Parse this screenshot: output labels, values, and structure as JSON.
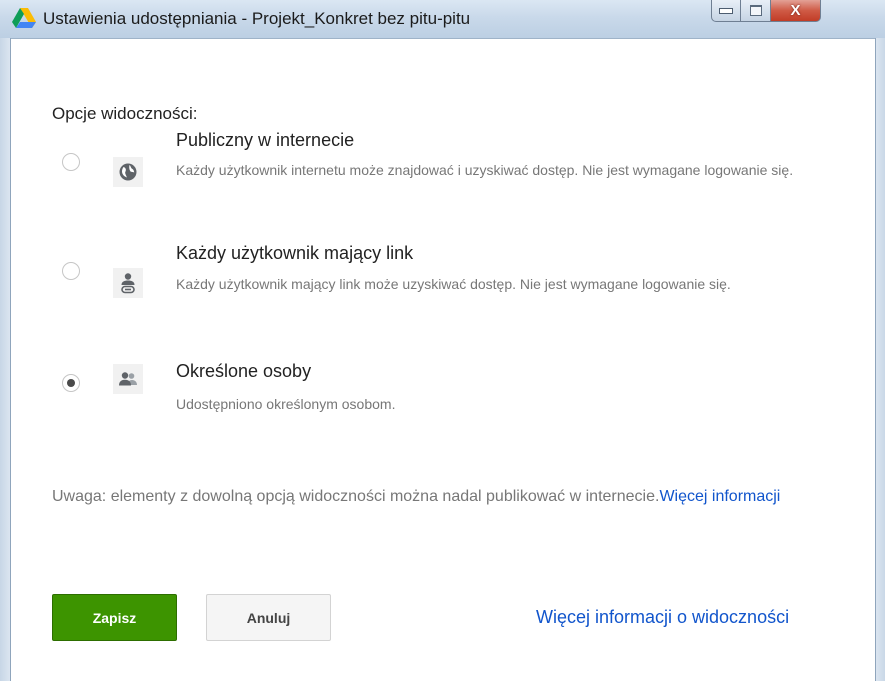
{
  "window": {
    "title": "Ustawienia udostępniania - Projekt_Konkret bez pitu-pitu",
    "app_icon": "google-drive-icon",
    "controls": {
      "minimize_icon": "minimize-icon",
      "maximize_icon": "maximize-icon",
      "close_glyph": "X"
    }
  },
  "visibility": {
    "heading": "Opcje widoczności:",
    "options": [
      {
        "title": "Publiczny w internecie",
        "description": "Każdy użytkownik internetu może znajdować i uzyskiwać dostęp. Nie jest wymagane logowanie się.",
        "icon": "globe-icon",
        "selected": false
      },
      {
        "title": "Każdy użytkownik mający link",
        "description": "Każdy użytkownik mający link może uzyskiwać dostęp. Nie jest wymagane logowanie się.",
        "icon": "person-link-icon",
        "selected": false
      },
      {
        "title": "Określone osoby",
        "description": "Udostępniono określonym osobom.",
        "icon": "people-icon",
        "selected": true
      }
    ]
  },
  "note": {
    "text": "Uwaga: elementy z dowolną opcją widoczności można nadal publikować w internecie.",
    "link": "Więcej informacji"
  },
  "buttons": {
    "save": "Zapisz",
    "cancel": "Anuluj",
    "more_info_link": "Więcej informacji o widoczności"
  },
  "colors": {
    "save_button": "#3d9400",
    "link": "#1155cc",
    "title_bar": "#c9d9ea",
    "close_button": "#c13c26"
  }
}
